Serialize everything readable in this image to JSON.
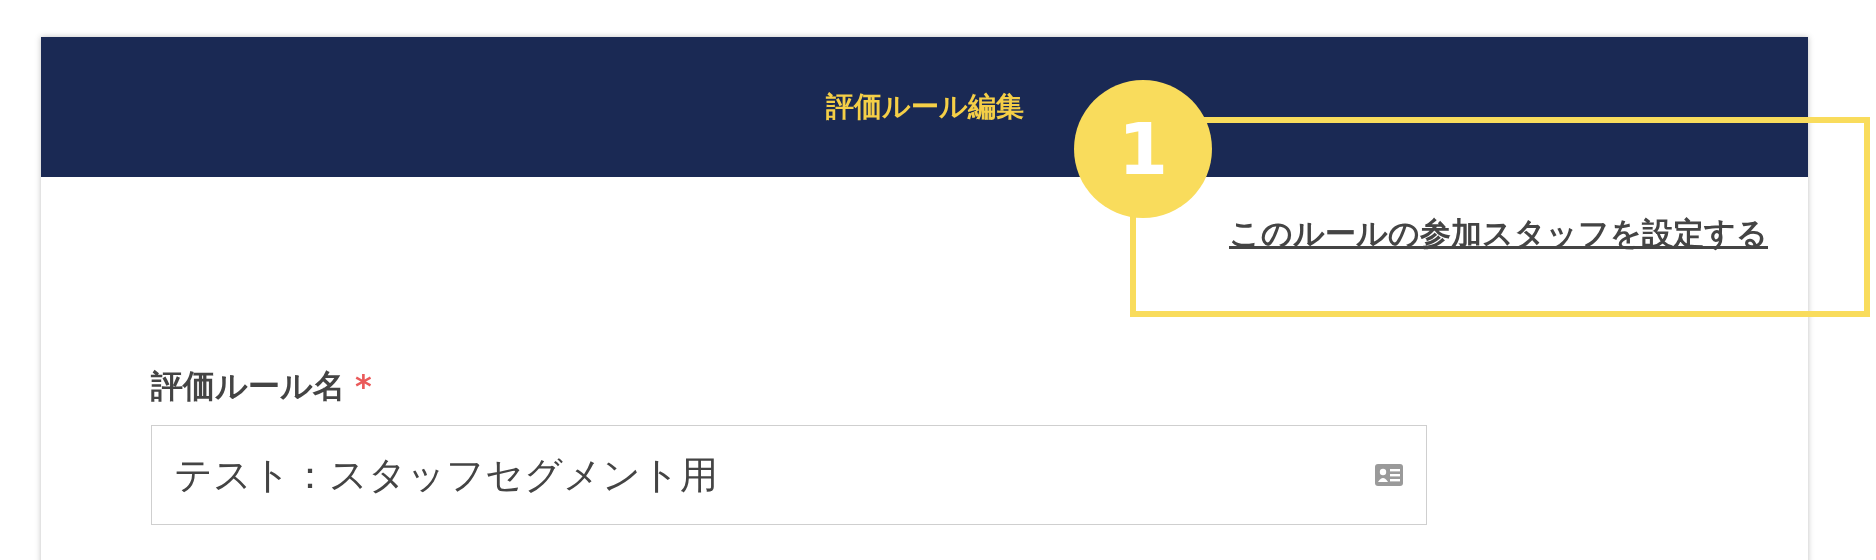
{
  "header": {
    "title": "評価ルール編集"
  },
  "callout": {
    "number": "1"
  },
  "link": "このルールの参加スタッフを設定する",
  "field": {
    "label": "評価ルール名",
    "required": true,
    "required_mark": "*",
    "value": "テスト：スタッフセグメント用"
  }
}
